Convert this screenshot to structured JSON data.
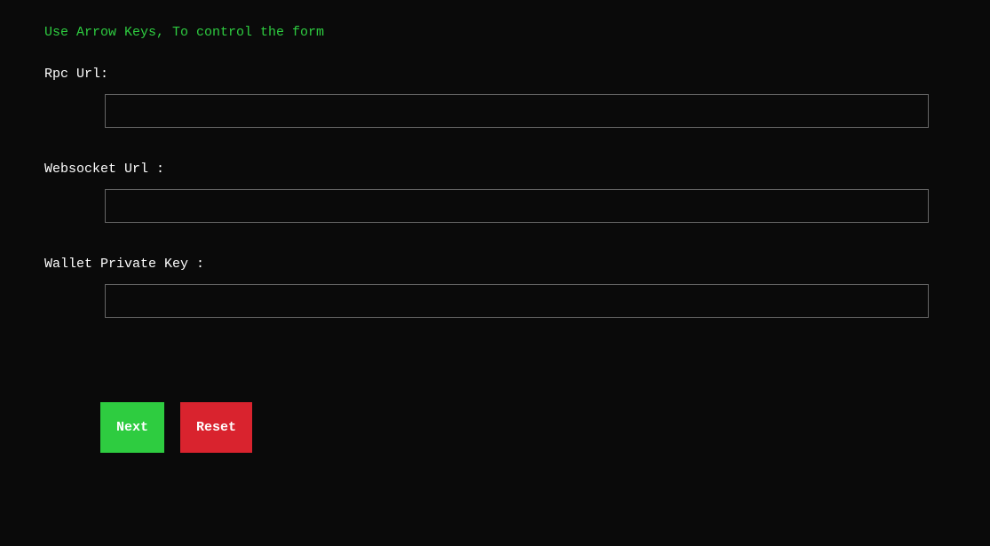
{
  "instruction": "Use Arrow Keys, To control the form",
  "form": {
    "fields": {
      "rpc": {
        "label": "Rpc Url:",
        "value": ""
      },
      "websocket": {
        "label": "Websocket Url :",
        "value": ""
      },
      "privateKey": {
        "label": "Wallet Private Key :",
        "value": ""
      }
    },
    "buttons": {
      "next": "Next",
      "reset": "Reset"
    }
  }
}
